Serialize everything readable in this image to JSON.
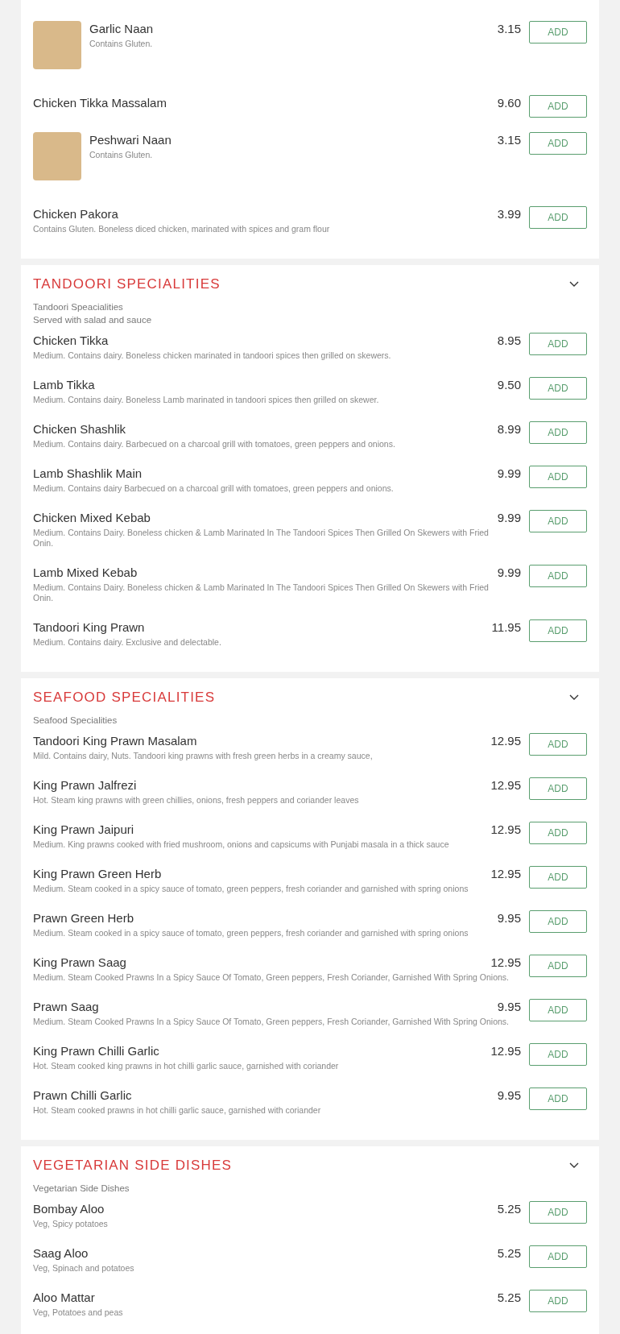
{
  "sections": [
    {
      "items": [
        {
          "name": "Garlic Naan",
          "description": "Contains Gluten.",
          "price": "3.15",
          "has_photo": true,
          "button": "ADD"
        },
        {
          "name": "Chicken Tikka Massalam",
          "price": "9.60",
          "has_photo": false,
          "button": "ADD"
        },
        {
          "name": "Peshwari Naan",
          "description": "Contains Gluten.",
          "price": "3.15",
          "has_photo": true,
          "button": "ADD"
        },
        {
          "name": "Chicken Pakora",
          "description": "Contains Gluten. Boneless diced chicken, marinated with spices and gram flour",
          "price": "3.99",
          "has_photo": false,
          "button": "ADD"
        }
      ]
    },
    {
      "title": "TANDOORI SPECIALITIES",
      "notes": [
        "Tandoori Speacialities",
        "Served with salad and sauce"
      ],
      "items": [
        {
          "name": "Chicken Tikka",
          "description": "Medium. Contains dairy. Boneless chicken marinated in tandoori spices then grilled on skewers.",
          "price": "8.95",
          "has_photo": false,
          "button": "ADD"
        },
        {
          "name": "Lamb Tikka",
          "description": "Medium. Contains dairy. Boneless Lamb marinated in tandoori spices then grilled on skewer.",
          "price": "9.50",
          "has_photo": false,
          "button": "ADD"
        },
        {
          "name": "Chicken Shashlik",
          "description": "Medium. Contains dairy. Barbecued on a charcoal grill with tomatoes, green peppers and onions.",
          "price": "8.99",
          "has_photo": false,
          "button": "ADD"
        },
        {
          "name": "Lamb Shashlik Main",
          "description": "Medium. Contains dairy Barbecued on a charcoal grill with tomatoes, green peppers and onions.",
          "price": "9.99",
          "has_photo": false,
          "button": "ADD"
        },
        {
          "name": "Chicken Mixed Kebab",
          "description": "Medium. Contains Dairy. Boneless chicken & Lamb Marinated In The Tandoori Spices Then Grilled On Skewers with Fried Onin.",
          "price": "9.99",
          "has_photo": false,
          "button": "ADD"
        },
        {
          "name": "Lamb Mixed Kebab",
          "description": "Medium. Contains Dairy. Boneless chicken & Lamb Marinated In The Tandoori Spices Then Grilled On Skewers with Fried Onin.",
          "price": "9.99",
          "has_photo": false,
          "button": "ADD"
        },
        {
          "name": "Tandoori King Prawn",
          "description": "Medium. Contains dairy. Exclusive and delectable.",
          "price": "11.95",
          "has_photo": false,
          "button": "ADD"
        }
      ]
    },
    {
      "title": "SEAFOOD SPECIALITIES",
      "notes": [
        "Seafood Specialities"
      ],
      "items": [
        {
          "name": "Tandoori King Prawn Masalam",
          "description": "Mild. Contains dairy, Nuts. Tandoori king prawns with fresh green herbs in a creamy sauce,",
          "price": "12.95",
          "has_photo": false,
          "button": "ADD"
        },
        {
          "name": "King Prawn Jalfrezi",
          "description": "Hot. Steam king prawns with green chillies, onions, fresh peppers and coriander leaves",
          "price": "12.95",
          "has_photo": false,
          "button": "ADD"
        },
        {
          "name": "King Prawn Jaipuri",
          "description": "Medium. King prawns cooked with fried mushroom, onions and capsicums with Punjabi masala in a thick sauce",
          "price": "12.95",
          "has_photo": false,
          "button": "ADD"
        },
        {
          "name": "King Prawn Green Herb",
          "description": "Medium. Steam cooked in a spicy sauce of tomato, green peppers, fresh coriander and garnished with spring onions",
          "price": "12.95",
          "has_photo": false,
          "button": "ADD"
        },
        {
          "name": "Prawn Green Herb",
          "description": "Medium. Steam cooked in a spicy sauce of tomato, green peppers, fresh coriander and garnished with spring onions",
          "price": "9.95",
          "has_photo": false,
          "button": "ADD"
        },
        {
          "name": "King Prawn Saag",
          "description": "Medium. Steam Cooked Prawns In a Spicy Sauce Of Tomato, Green peppers, Fresh Coriander, Garnished With Spring Onions.",
          "price": "12.95",
          "has_photo": false,
          "button": "ADD"
        },
        {
          "name": "Prawn Saag",
          "description": "Medium. Steam Cooked Prawns In a Spicy Sauce Of Tomato, Green peppers, Fresh Coriander, Garnished With Spring Onions.",
          "price": "9.95",
          "has_photo": false,
          "button": "ADD"
        },
        {
          "name": "King Prawn Chilli Garlic",
          "description": "Hot. Steam cooked king prawns in hot chilli garlic sauce, garnished with coriander",
          "price": "12.95",
          "has_photo": false,
          "button": "ADD"
        },
        {
          "name": "Prawn Chilli Garlic",
          "description": "Hot. Steam cooked prawns in hot chilli garlic sauce, garnished with coriander",
          "price": "9.95",
          "has_photo": false,
          "button": "ADD"
        }
      ]
    },
    {
      "title": "VEGETARIAN SIDE DISHES",
      "notes": [
        "Vegetarian Side Dishes"
      ],
      "items": [
        {
          "name": "Bombay Aloo",
          "description": "Veg, Spicy potatoes",
          "price": "5.25",
          "has_photo": false,
          "button": "ADD"
        },
        {
          "name": "Saag Aloo",
          "description": "Veg, Spinach and potatoes",
          "price": "5.25",
          "has_photo": false,
          "button": "ADD"
        },
        {
          "name": "Aloo Mattar",
          "description": "Veg, Potatoes and peas",
          "price": "5.25",
          "has_photo": false,
          "button": "ADD"
        }
      ]
    }
  ]
}
